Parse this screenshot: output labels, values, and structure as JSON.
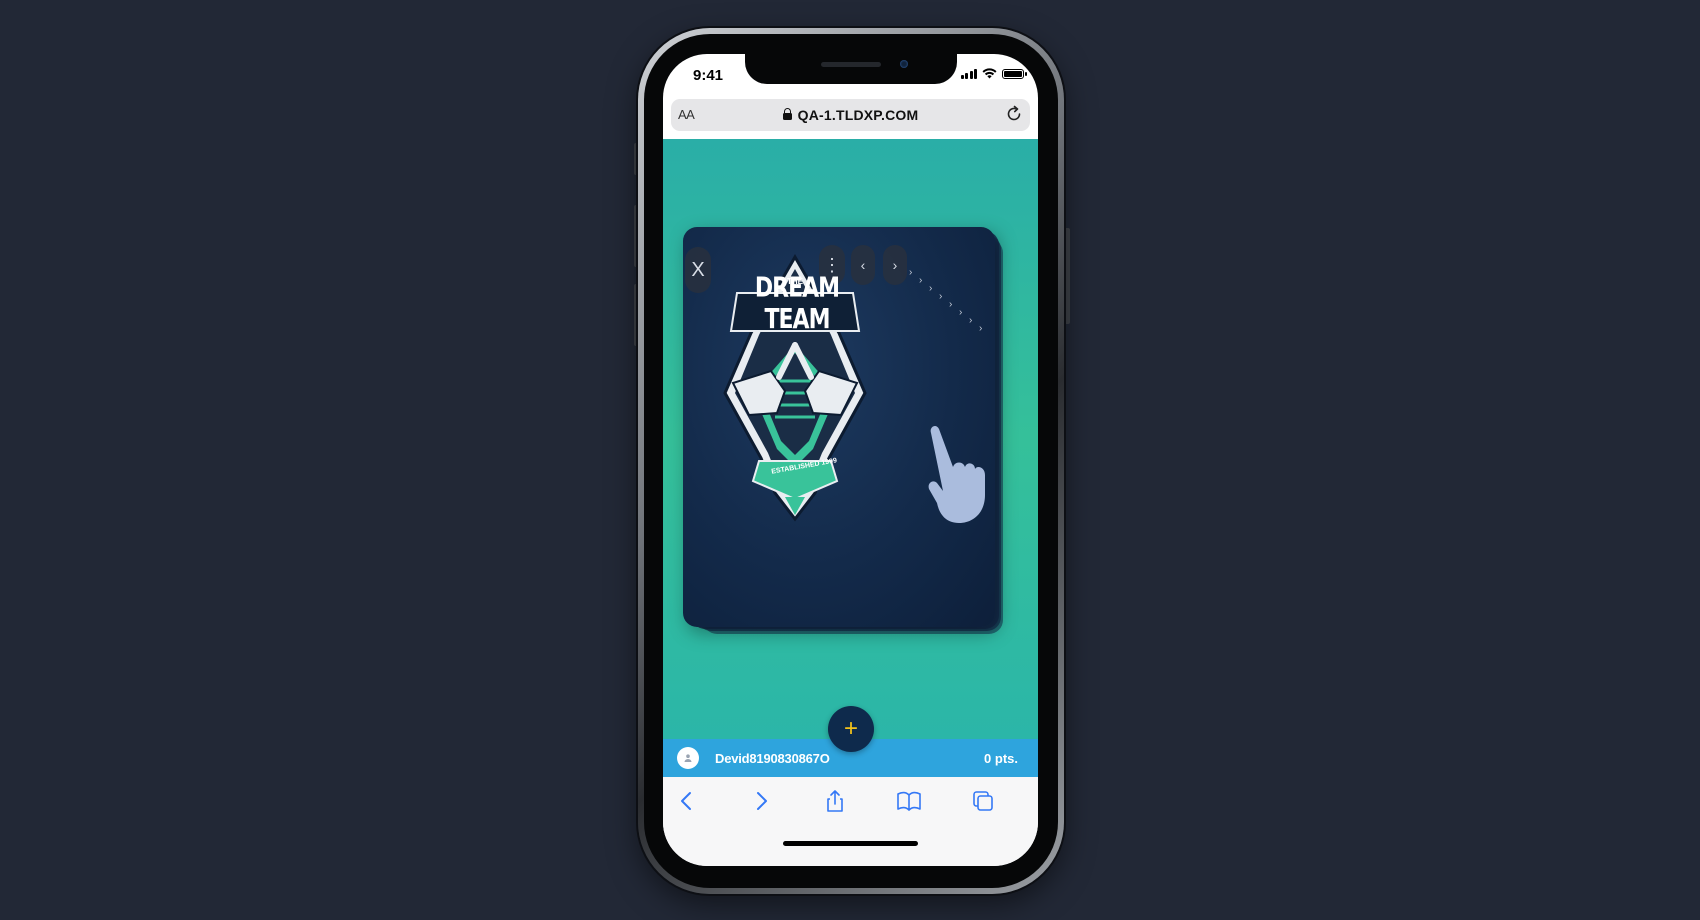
{
  "status_bar": {
    "time": "9:41"
  },
  "browser": {
    "text_size_label": "AA",
    "url": "QA-1.TLDXP.COM"
  },
  "card": {
    "close_symbol": "X",
    "menu_symbol": "⋮",
    "prev_symbol": "‹",
    "next_symbol": "›",
    "logo": {
      "pre_title": "THE",
      "title": "DREAM TEAM",
      "ribbon": "ESTABLISHED 1999"
    }
  },
  "add_button": {
    "symbol": "+"
  },
  "user_bar": {
    "username": "Devid8190830867O",
    "points": "0 pts."
  },
  "colors": {
    "background": "#222836",
    "content_bg": "#35c09a",
    "card_bg": "#132a4a",
    "user_bar": "#2ea4dd",
    "fab_bg": "#0e2a4c",
    "fab_plus": "#f2c21b",
    "safari_blue": "#3478f6"
  },
  "icons": [
    "lock-icon",
    "reload-icon",
    "back-icon",
    "forward-icon",
    "share-icon",
    "bookmarks-icon",
    "tabs-icon",
    "hand-pointer-icon",
    "user-avatar-icon"
  ]
}
